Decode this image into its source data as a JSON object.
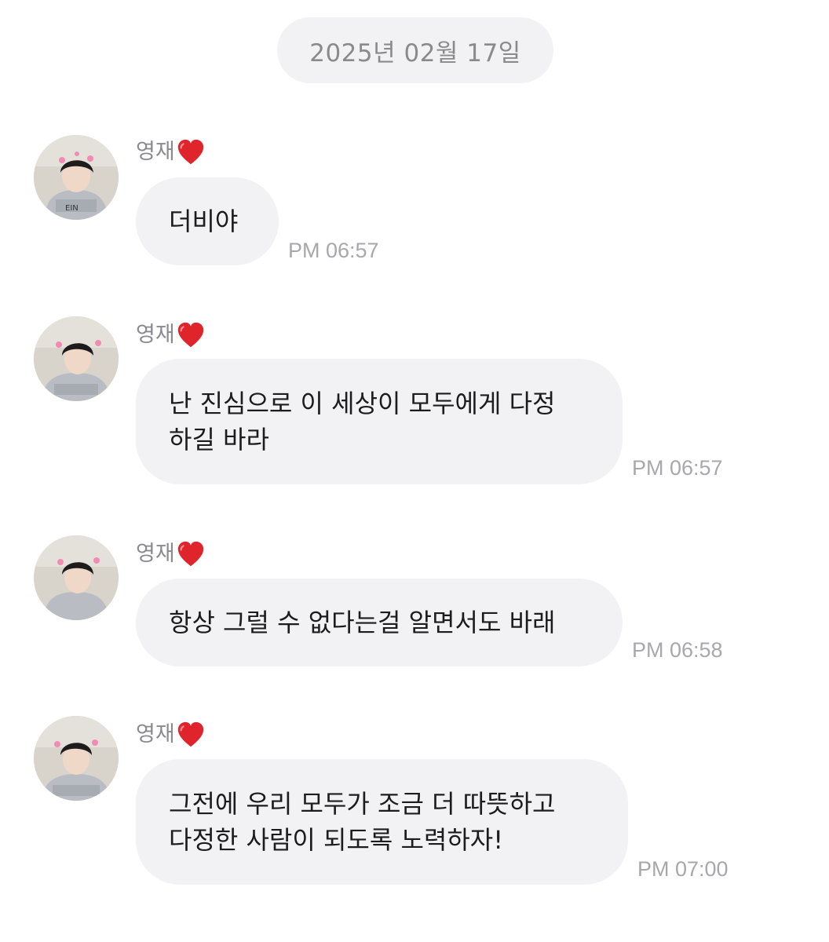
{
  "date_label": "2025년 02월 17일",
  "messages": [
    {
      "sender": "영재",
      "sender_icon": "red-heart-emoji",
      "text": "더비야",
      "time": "PM 06:57"
    },
    {
      "sender": "영재",
      "sender_icon": "red-heart-emoji",
      "text": "난 진심으로 이 세상이 모두에게 다정\n하길 바라",
      "time": "PM 06:57"
    },
    {
      "sender": "영재",
      "sender_icon": "red-heart-emoji",
      "text": "항상 그럴 수 없다는걸 알면서도 바래",
      "time": "PM 06:58"
    },
    {
      "sender": "영재",
      "sender_icon": "red-heart-emoji",
      "text": "그전에 우리 모두가 조금 더 따뜻하고\n다정한 사람이 되도록 노력하자!",
      "time": "PM 07:00"
    }
  ],
  "colors": {
    "bubble_bg": "#f2f2f4",
    "meta_text": "#8a8a8e",
    "time_text": "#a8a8ac",
    "heart": "#e0242b"
  }
}
